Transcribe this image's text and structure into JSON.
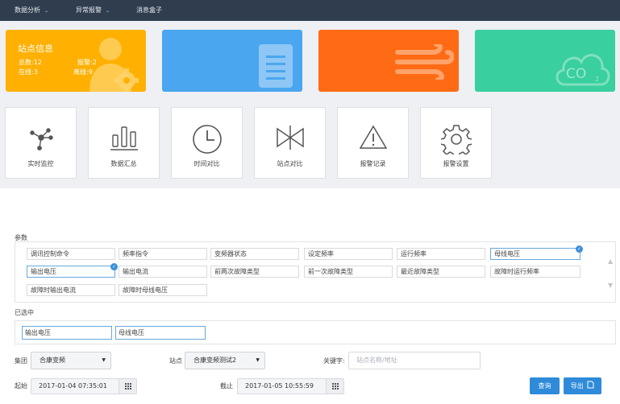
{
  "nav": {
    "items": [
      {
        "label": "数据分析",
        "has_dropdown": true
      },
      {
        "label": "异常报警",
        "has_dropdown": true
      },
      {
        "label": "消息盒子",
        "has_dropdown": false
      }
    ]
  },
  "cards": {
    "station": {
      "title": "站点信息",
      "total": "总数:12",
      "alarm": "报警:2",
      "online": "在线:3",
      "offline": "离线:9",
      "color": "#ffb000",
      "icon": "user-gear-icon"
    },
    "document": {
      "color": "#4aa6ee",
      "icon": "document-icon"
    },
    "wind": {
      "color": "#ff6a14",
      "icon": "wind-icon"
    },
    "co2": {
      "color": "#39cf9e",
      "icon": "co2-cloud-icon",
      "icon_text": "CO",
      "icon_sub": "2"
    }
  },
  "tiles": [
    {
      "label": "实时监控",
      "icon": "network-icon"
    },
    {
      "label": "数据汇总",
      "icon": "bar-chart-icon"
    },
    {
      "label": "时间对比",
      "icon": "clock-icon"
    },
    {
      "label": "站点对比",
      "icon": "valve-icon"
    },
    {
      "label": "报警记录",
      "icon": "warning-icon"
    },
    {
      "label": "报警设置",
      "icon": "gear-icon"
    }
  ],
  "params": {
    "label": "参数",
    "rows": [
      [
        "调讯控制命令",
        "频率指令",
        "变频器状态",
        "设定频率",
        "运行频率",
        "母线电压"
      ],
      [
        "输出电压",
        "输出电流",
        "前两次故障类型",
        "前一次故障类型",
        "最近故障类型",
        "故障时运行频率"
      ],
      [
        "故障时输出电流",
        "故障时母线电压"
      ]
    ],
    "selected_flags": [
      [
        false,
        false,
        false,
        false,
        false,
        true
      ],
      [
        true,
        false,
        false,
        false,
        false,
        false
      ],
      [
        false,
        false
      ]
    ],
    "scroll_up": "▲",
    "scroll_down": "▼"
  },
  "selected": {
    "label": "已选中",
    "items": [
      "输出电压",
      "母线电压"
    ]
  },
  "form": {
    "group_label": "集团",
    "group_value": "合康变频",
    "station_label": "站点",
    "station_value": "合康变频测试2",
    "keyword_label": "关键字:",
    "keyword_placeholder": "站点名称/地址",
    "start_label": "起始",
    "start_value": "2017-01-04 07:35:01",
    "end_label": "截止",
    "end_value": "2017-01-05 10:55:59",
    "query_label": "查询",
    "export_label": "导出",
    "accent": "#2f8bd9"
  }
}
